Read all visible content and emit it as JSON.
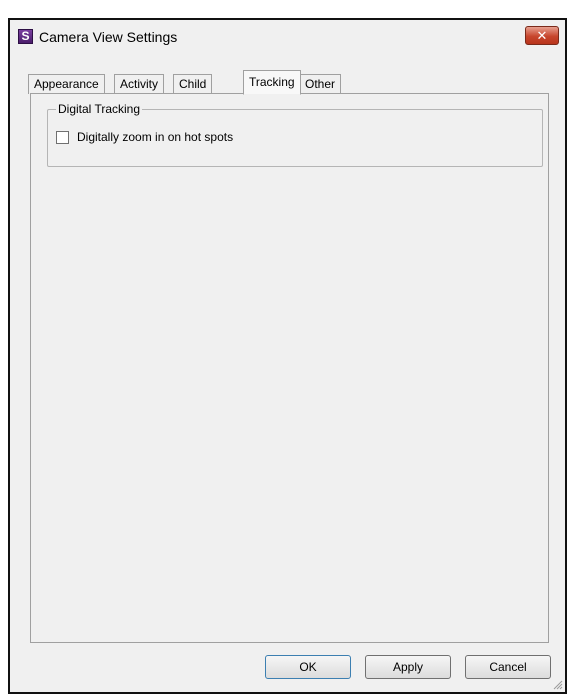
{
  "window": {
    "title": "Camera View Settings",
    "app_icon_letter": "S",
    "close_glyph": "✕"
  },
  "tabs": [
    {
      "label": "Appearance",
      "active": false
    },
    {
      "label": "Activity",
      "active": false
    },
    {
      "label": "Child",
      "active": false
    },
    {
      "label": "Tracking",
      "active": true
    },
    {
      "label": "Other",
      "active": false
    }
  ],
  "tracking": {
    "group_title": "Digital Tracking",
    "zoom_checkbox_label": "Digitally zoom in on hot spots",
    "zoom_checked": false
  },
  "buttons": {
    "ok": "OK",
    "apply": "Apply",
    "cancel": "Cancel"
  },
  "colors": {
    "app_icon": "#5b2a82",
    "close_button": "#c7462d",
    "dialog_bg": "#f0f0f0"
  }
}
